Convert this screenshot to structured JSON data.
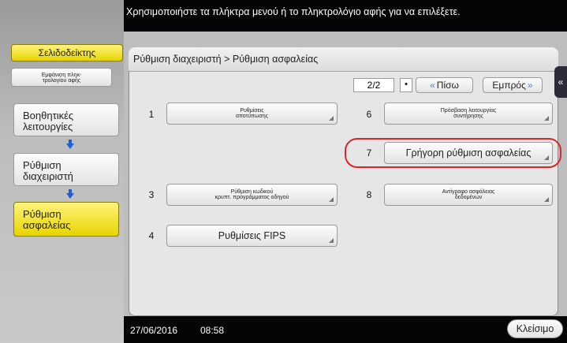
{
  "instruction": "Χρησιμοποιήστε τα πλήκτρα μενού ή το πληκτρολόγιο αφής για να επιλέξετε.",
  "sidebar": {
    "bookmark_label": "Σελιδοδείκτης",
    "keypad_label_line1": "Εμφάνιση πληκ-",
    "keypad_label_line2": "τρολογίου αφής",
    "nav": [
      {
        "line1": "Βοηθητικές",
        "line2": "λειτουργίες"
      },
      {
        "line1": "Ρύθμιση",
        "line2": "διαχειριστή"
      },
      {
        "line1": "Ρύθμιση",
        "line2": "ασφαλείας"
      }
    ]
  },
  "breadcrumb": "Ρύθμιση διαχειριστή > Ρύθμιση ασφαλείας",
  "pager": {
    "page": "2/2",
    "dot": "•",
    "back_label": "Πίσω",
    "forward_label": "Εμπρός"
  },
  "menu": [
    {
      "num": "1",
      "line1": "Ρυθμίσεις",
      "line2": "αποτύπωσης"
    },
    {
      "num": "6",
      "line1": "Πρόσβαση λειτουργίας",
      "line2": "συντήρησης"
    },
    {
      "num": "7",
      "label": "Γρήγορη ρύθμιση ασφαλείας"
    },
    {
      "num": "3",
      "line1": "Ρύθμιση κωδικού",
      "line2": "κρυπτ. προγράμματος οδηγού"
    },
    {
      "num": "8",
      "line1": "Αντίγραφο ασφάλειας",
      "line2": "δεδομένων"
    },
    {
      "num": "4",
      "label": "Ρυθμίσεις FIPS"
    }
  ],
  "status": {
    "date": "27/06/2016",
    "time": "08:58",
    "close_label": "Κλείσιμο"
  },
  "colors": {
    "accent_yellow": "#f2e000",
    "highlight_red": "#d8262c",
    "arrow_blue": "#1f5fd6"
  }
}
